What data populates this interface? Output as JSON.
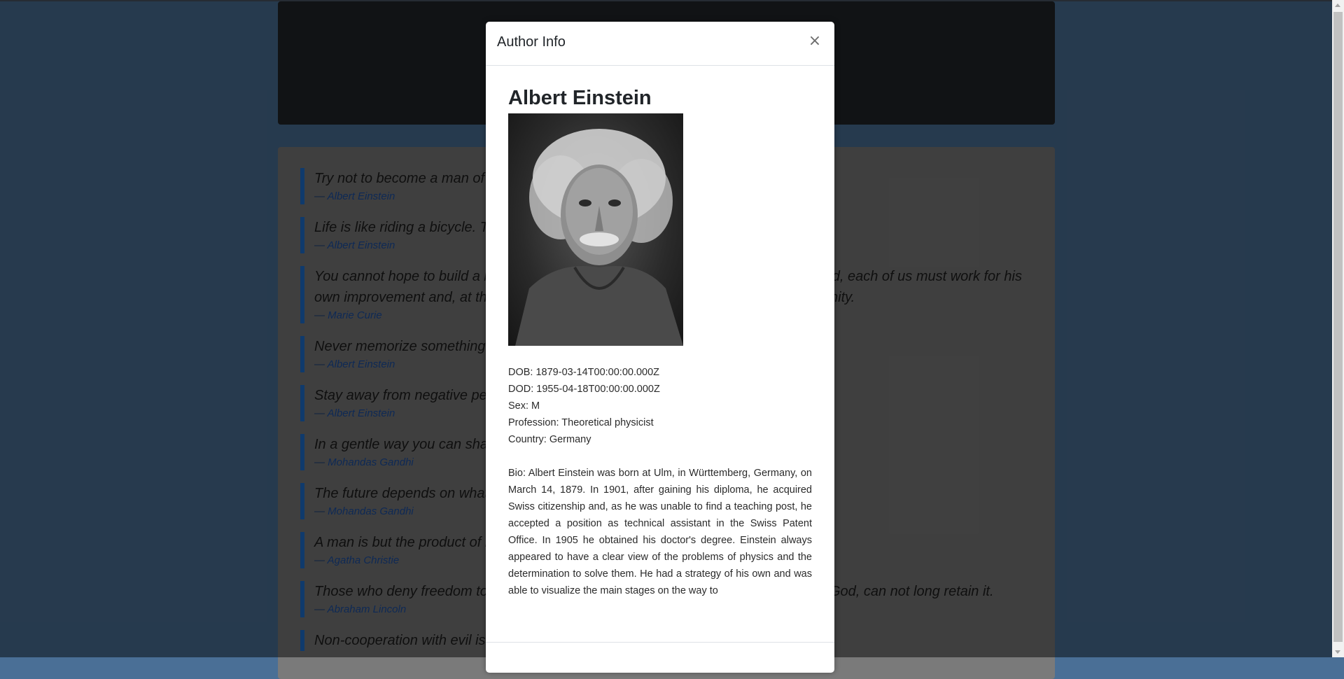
{
  "quotes": [
    {
      "text": "Try not to become a man of success. Rather become a man of value.",
      "author": "Albert Einstein"
    },
    {
      "text": "Life is like riding a bicycle. To keep your balance you must keep moving.",
      "author": "Albert Einstein"
    },
    {
      "text": "You cannot hope to build a better world without improving the individuals. To that end, each of us must work for his own improvement and, at the same time, share a general responsibility for all humanity.",
      "author": "Marie Curie"
    },
    {
      "text": "Never memorize something that you can look up.",
      "author": "Albert Einstein"
    },
    {
      "text": "Stay away from negative people. They have a problem for every solution.",
      "author": "Albert Einstein"
    },
    {
      "text": "In a gentle way you can shake the world.",
      "author": "Mohandas Gandhi"
    },
    {
      "text": "The future depends on what you do today.",
      "author": "Mohandas Gandhi"
    },
    {
      "text": "A man is but the product of his thoughts. What he thinks, he becomes.",
      "author": "Agatha Christie"
    },
    {
      "text": "Those who deny freedom to others deserve it not for themselves; and, under a just God, can not long retain it.",
      "author": "Abraham Lincoln"
    },
    {
      "text": "Non-cooperation with evil is as much a duty as is cooperation with good.",
      "author": ""
    }
  ],
  "modal": {
    "title": "Author Info",
    "close_label": "×",
    "author_name": "Albert Einstein",
    "details": {
      "dob": "DOB: 1879-03-14T00:00:00.000Z",
      "dod": "DOD: 1955-04-18T00:00:00.000Z",
      "sex": "Sex: M",
      "profession": "Profession: Theoretical physicist",
      "country": "Country: Germany"
    },
    "bio": "Bio: Albert Einstein was born at Ulm, in Württemberg, Germany, on March 14, 1879. In 1901, after gaining his diploma, he acquired Swiss citizenship and, as he was unable to find a teaching post, he accepted a position as technical assistant in the Swiss Patent Office. In 1905 he obtained his doctor's degree. Einstein always appeared to have a clear view of the problems of physics and the determination to solve them. He had a strategy of his own and was able to visualize the main stages on the way to"
  }
}
